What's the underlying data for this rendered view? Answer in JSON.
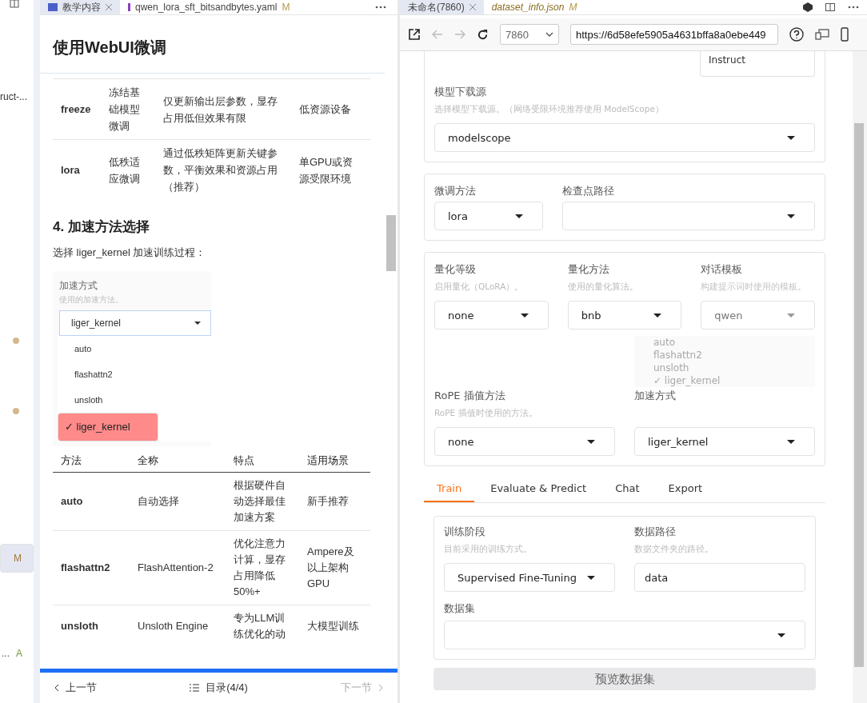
{
  "explorer": [
    {
      "kind": "text",
      "label": "ruct-..."
    },
    {
      "kind": "dot",
      "color": "#d4b98c"
    },
    {
      "kind": "dot",
      "color": "#d4b98c"
    },
    {
      "kind": "badge",
      "label": "M",
      "selected": true
    },
    {
      "kind": "badge",
      "prefix": "...",
      "label": "A",
      "selected": false
    }
  ],
  "left_tabs": [
    {
      "label": "教学内容",
      "selected": true
    },
    {
      "label": "qwen_lora_sft_bitsandbytes.yaml",
      "badge": "M",
      "selected": false
    }
  ],
  "doc": {
    "title": "使用WebUI微调",
    "table_1": {
      "rows": [
        [
          "freeze",
          "冻结基础模型微调",
          "仅更新输出层参数，显存占用低但效果有限",
          "低资源设备"
        ],
        [
          "lora",
          "低秩适应微调",
          "通过低秩矩阵更新关键参数，平衡效果和资源占用（推荐）",
          "单GPU或资源受限环境"
        ]
      ]
    },
    "section": "4. 加速方法选择",
    "paragraph": "选择 liger_kernel 加速训练过程：",
    "screenshot": {
      "label": "加速方式",
      "hint": "使用的加速方法。",
      "value": "liger_kernel",
      "options": [
        {
          "label": "auto",
          "selected": false
        },
        {
          "label": "flashattn2",
          "selected": false
        },
        {
          "label": "unsloth",
          "selected": false
        },
        {
          "label": "✓ liger_kernel",
          "selected": true
        }
      ]
    },
    "table_2": {
      "columns": [
        "方法",
        "全称",
        "特点",
        "适用场景"
      ],
      "rows": [
        [
          "auto",
          "自动选择",
          "根据硬件自动选择最佳加速方案",
          "新手推荐"
        ],
        [
          "flashattn2",
          "FlashAttention-2",
          "优化注意力计算，显存占用降低50%+",
          "Ampere及以上架构GPU"
        ],
        [
          "unsloth",
          "Unsloth Engine",
          "专为LLM训练优化的动",
          "大模型训练"
        ]
      ]
    }
  },
  "doc_nav": {
    "prev": {
      "label": "上一节",
      "disabled": false
    },
    "toc": "目录(4/4)",
    "next": {
      "label": "下一节",
      "disabled": true
    }
  },
  "right_tabs": [
    {
      "label": "未命名(7860)",
      "selected": true
    },
    {
      "label": "dataset_info.json",
      "badge": "M",
      "selected": false
    }
  ],
  "browser": {
    "port": "7860",
    "url": "https://6d58efe5905a4631bffa8a0ebe449"
  },
  "webui": {
    "top_value": "Instruct",
    "download_source": {
      "label": "模型下载源",
      "hint": "选择模型下载源。（网络受限环境推荐使用 ModelScope）",
      "value": "modelscope"
    },
    "method_row": [
      {
        "label": "微调方法",
        "value": "lora"
      },
      {
        "label": "检查点路径"
      }
    ],
    "quant_row": [
      {
        "label": "量化等级",
        "hint": "启用量化（QLoRA）。",
        "value": "none"
      },
      {
        "label": "量化方法",
        "hint": "使用的量化算法。",
        "value": "bnb"
      },
      {
        "label": "对话模板",
        "hint": "构建提示词时使用的模板。",
        "value": "qwen",
        "faded": true
      }
    ],
    "rope_row": [
      {
        "label": "RoPE 插值方法",
        "hint": "RoPE 插值时使用的方法。",
        "value": "none"
      },
      {
        "label": "加速方式",
        "value": "liger_kernel"
      }
    ],
    "ghost_menu": [
      "auto",
      "flashattn2",
      "unsloth",
      "✓ liger_kernel"
    ],
    "tabs": [
      {
        "label": "Train",
        "selected": true
      },
      {
        "label": "Evaluate & Predict",
        "selected": false
      },
      {
        "label": "Chat",
        "selected": false
      },
      {
        "label": "Export",
        "selected": false
      }
    ],
    "train": {
      "stage": {
        "label": "训练阶段",
        "hint": "目前采用的训练方式。",
        "value": "Supervised Fine-Tuning"
      },
      "data_dir": {
        "label": "数据路径",
        "hint": "数据文件夹的路径。",
        "value": "data"
      },
      "dataset": {
        "label": "数据集"
      },
      "preview_button": "预览数据集"
    }
  }
}
